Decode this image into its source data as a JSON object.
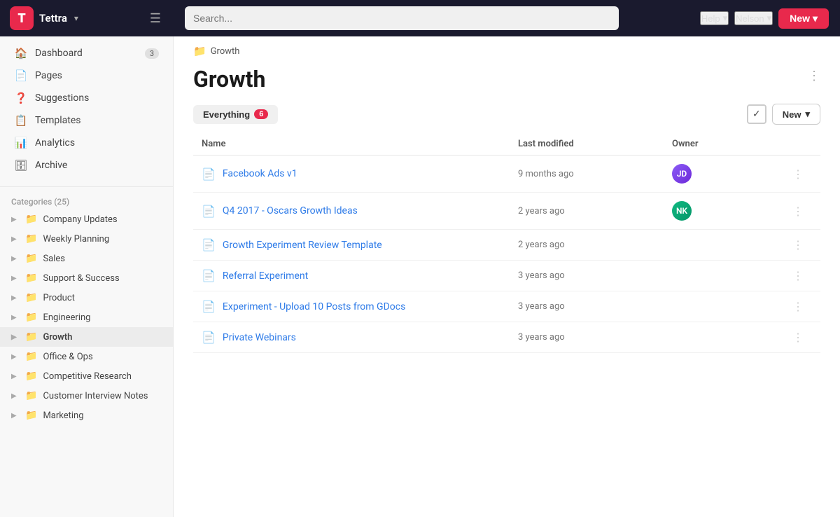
{
  "topbar": {
    "logo_letter": "T",
    "app_name": "Tettra",
    "search_placeholder": "Search...",
    "help_label": "Help",
    "user_label": "Nelson",
    "new_button_label": "New"
  },
  "sidebar": {
    "nav_items": [
      {
        "id": "dashboard",
        "label": "Dashboard",
        "icon": "🏠",
        "badge": "3"
      },
      {
        "id": "pages",
        "label": "Pages",
        "icon": "📄",
        "badge": ""
      },
      {
        "id": "suggestions",
        "label": "Suggestions",
        "icon": "❓",
        "badge": ""
      },
      {
        "id": "templates",
        "label": "Templates",
        "icon": "📋",
        "badge": ""
      },
      {
        "id": "analytics",
        "label": "Analytics",
        "icon": "📊",
        "badge": ""
      },
      {
        "id": "archive",
        "label": "Archive",
        "icon": "🗄",
        "badge": ""
      }
    ],
    "categories_header": "Categories (25)",
    "categories": [
      {
        "id": "company-updates",
        "label": "Company Updates",
        "active": false
      },
      {
        "id": "weekly-planning",
        "label": "Weekly Planning",
        "active": false
      },
      {
        "id": "sales",
        "label": "Sales",
        "active": false
      },
      {
        "id": "support-success",
        "label": "Support & Success",
        "active": false
      },
      {
        "id": "product",
        "label": "Product",
        "active": false
      },
      {
        "id": "engineering",
        "label": "Engineering",
        "active": false
      },
      {
        "id": "growth",
        "label": "Growth",
        "active": true
      },
      {
        "id": "office-ops",
        "label": "Office & Ops",
        "active": false
      },
      {
        "id": "competitive-research",
        "label": "Competitive Research",
        "active": false
      },
      {
        "id": "customer-interview-notes",
        "label": "Customer Interview Notes",
        "active": false
      },
      {
        "id": "marketing",
        "label": "Marketing",
        "active": false
      }
    ]
  },
  "breadcrumb": {
    "folder_icon": "📁",
    "text": "Growth"
  },
  "page": {
    "title": "Growth",
    "filter_label": "Everything",
    "filter_count": "6",
    "new_button_label": "New"
  },
  "table": {
    "columns": {
      "name": "Name",
      "last_modified": "Last modified",
      "owner": "Owner"
    },
    "rows": [
      {
        "id": 1,
        "name": "Facebook Ads v1",
        "modified": "9 months ago",
        "has_avatar": true,
        "avatar_class": "av1",
        "avatar_initials": "JD"
      },
      {
        "id": 2,
        "name": "Q4 2017 - Oscars Growth Ideas",
        "modified": "2 years ago",
        "has_avatar": true,
        "avatar_class": "av2",
        "avatar_initials": "NK"
      },
      {
        "id": 3,
        "name": "Growth Experiment Review Template",
        "modified": "2 years ago",
        "has_avatar": false,
        "avatar_class": "",
        "avatar_initials": ""
      },
      {
        "id": 4,
        "name": "Referral Experiment",
        "modified": "3 years ago",
        "has_avatar": false,
        "avatar_class": "",
        "avatar_initials": ""
      },
      {
        "id": 5,
        "name": "Experiment - Upload 10 Posts from GDocs",
        "modified": "3 years ago",
        "has_avatar": false,
        "avatar_class": "",
        "avatar_initials": ""
      },
      {
        "id": 6,
        "name": "Private Webinars",
        "modified": "3 years ago",
        "has_avatar": false,
        "avatar_class": "",
        "avatar_initials": ""
      }
    ]
  }
}
